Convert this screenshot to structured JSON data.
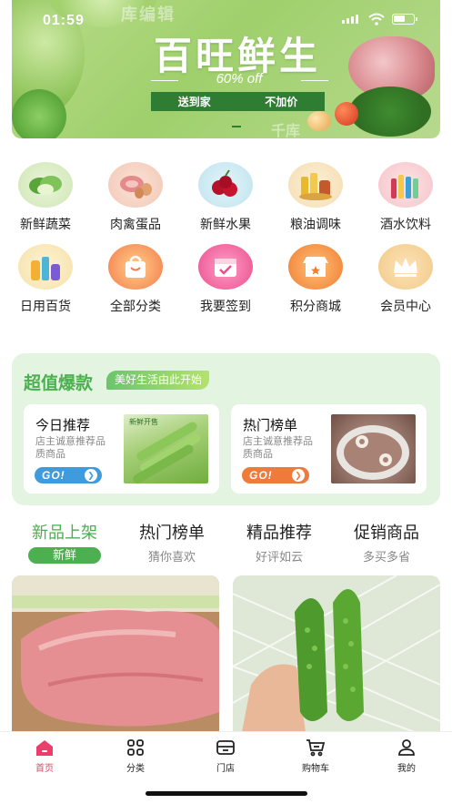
{
  "status_bar": {
    "time": "01:59"
  },
  "banner": {
    "title": "百旺鲜生",
    "discount": "60% off",
    "badges": [
      "送到家",
      "不加价"
    ],
    "watermark_top": "库编辑",
    "watermark_bottom": "千库"
  },
  "categories": [
    {
      "label": "新鲜蔬菜",
      "icon": "vegetables-icon"
    },
    {
      "label": "肉禽蛋品",
      "icon": "meat-eggs-icon"
    },
    {
      "label": "新鲜水果",
      "icon": "fruit-icon"
    },
    {
      "label": "粮油调味",
      "icon": "grain-oil-icon"
    },
    {
      "label": "酒水饮料",
      "icon": "drinks-icon"
    },
    {
      "label": "日用百货",
      "icon": "daily-goods-icon"
    },
    {
      "label": "全部分类",
      "icon": "shopping-bag-icon"
    },
    {
      "label": "我要签到",
      "icon": "calendar-checkin-icon"
    },
    {
      "label": "积分商城",
      "icon": "points-store-icon"
    },
    {
      "label": "会员中心",
      "icon": "crown-icon"
    }
  ],
  "deals": {
    "title": "超值爆款",
    "tagline": "美好生活由此开始",
    "cards": [
      {
        "title": "今日推荐",
        "desc": "店主诚意推荐品质商品",
        "go": "GO!",
        "accent": "#3f9bdc",
        "image_text": "新鲜开售"
      },
      {
        "title": "热门榜单",
        "desc": "店主诚意推荐品质商品",
        "go": "GO!",
        "accent": "#ef7a3c"
      }
    ]
  },
  "tabs": [
    {
      "title": "新品上架",
      "sub": "新鲜"
    },
    {
      "title": "热门榜单",
      "sub": "猜你喜欢"
    },
    {
      "title": "精品推荐",
      "sub": "好评如云"
    },
    {
      "title": "促销商品",
      "sub": "多买多省"
    }
  ],
  "bottom_nav": [
    {
      "label": "首页",
      "icon": "home-icon"
    },
    {
      "label": "分类",
      "icon": "grid-icon"
    },
    {
      "label": "门店",
      "icon": "store-icon"
    },
    {
      "label": "购物车",
      "icon": "cart-icon"
    },
    {
      "label": "我的",
      "icon": "user-icon"
    }
  ],
  "colors": {
    "brand_green": "#4caf50",
    "nav_active": "#e8406a",
    "deals_bg": "#e3f4e0"
  }
}
